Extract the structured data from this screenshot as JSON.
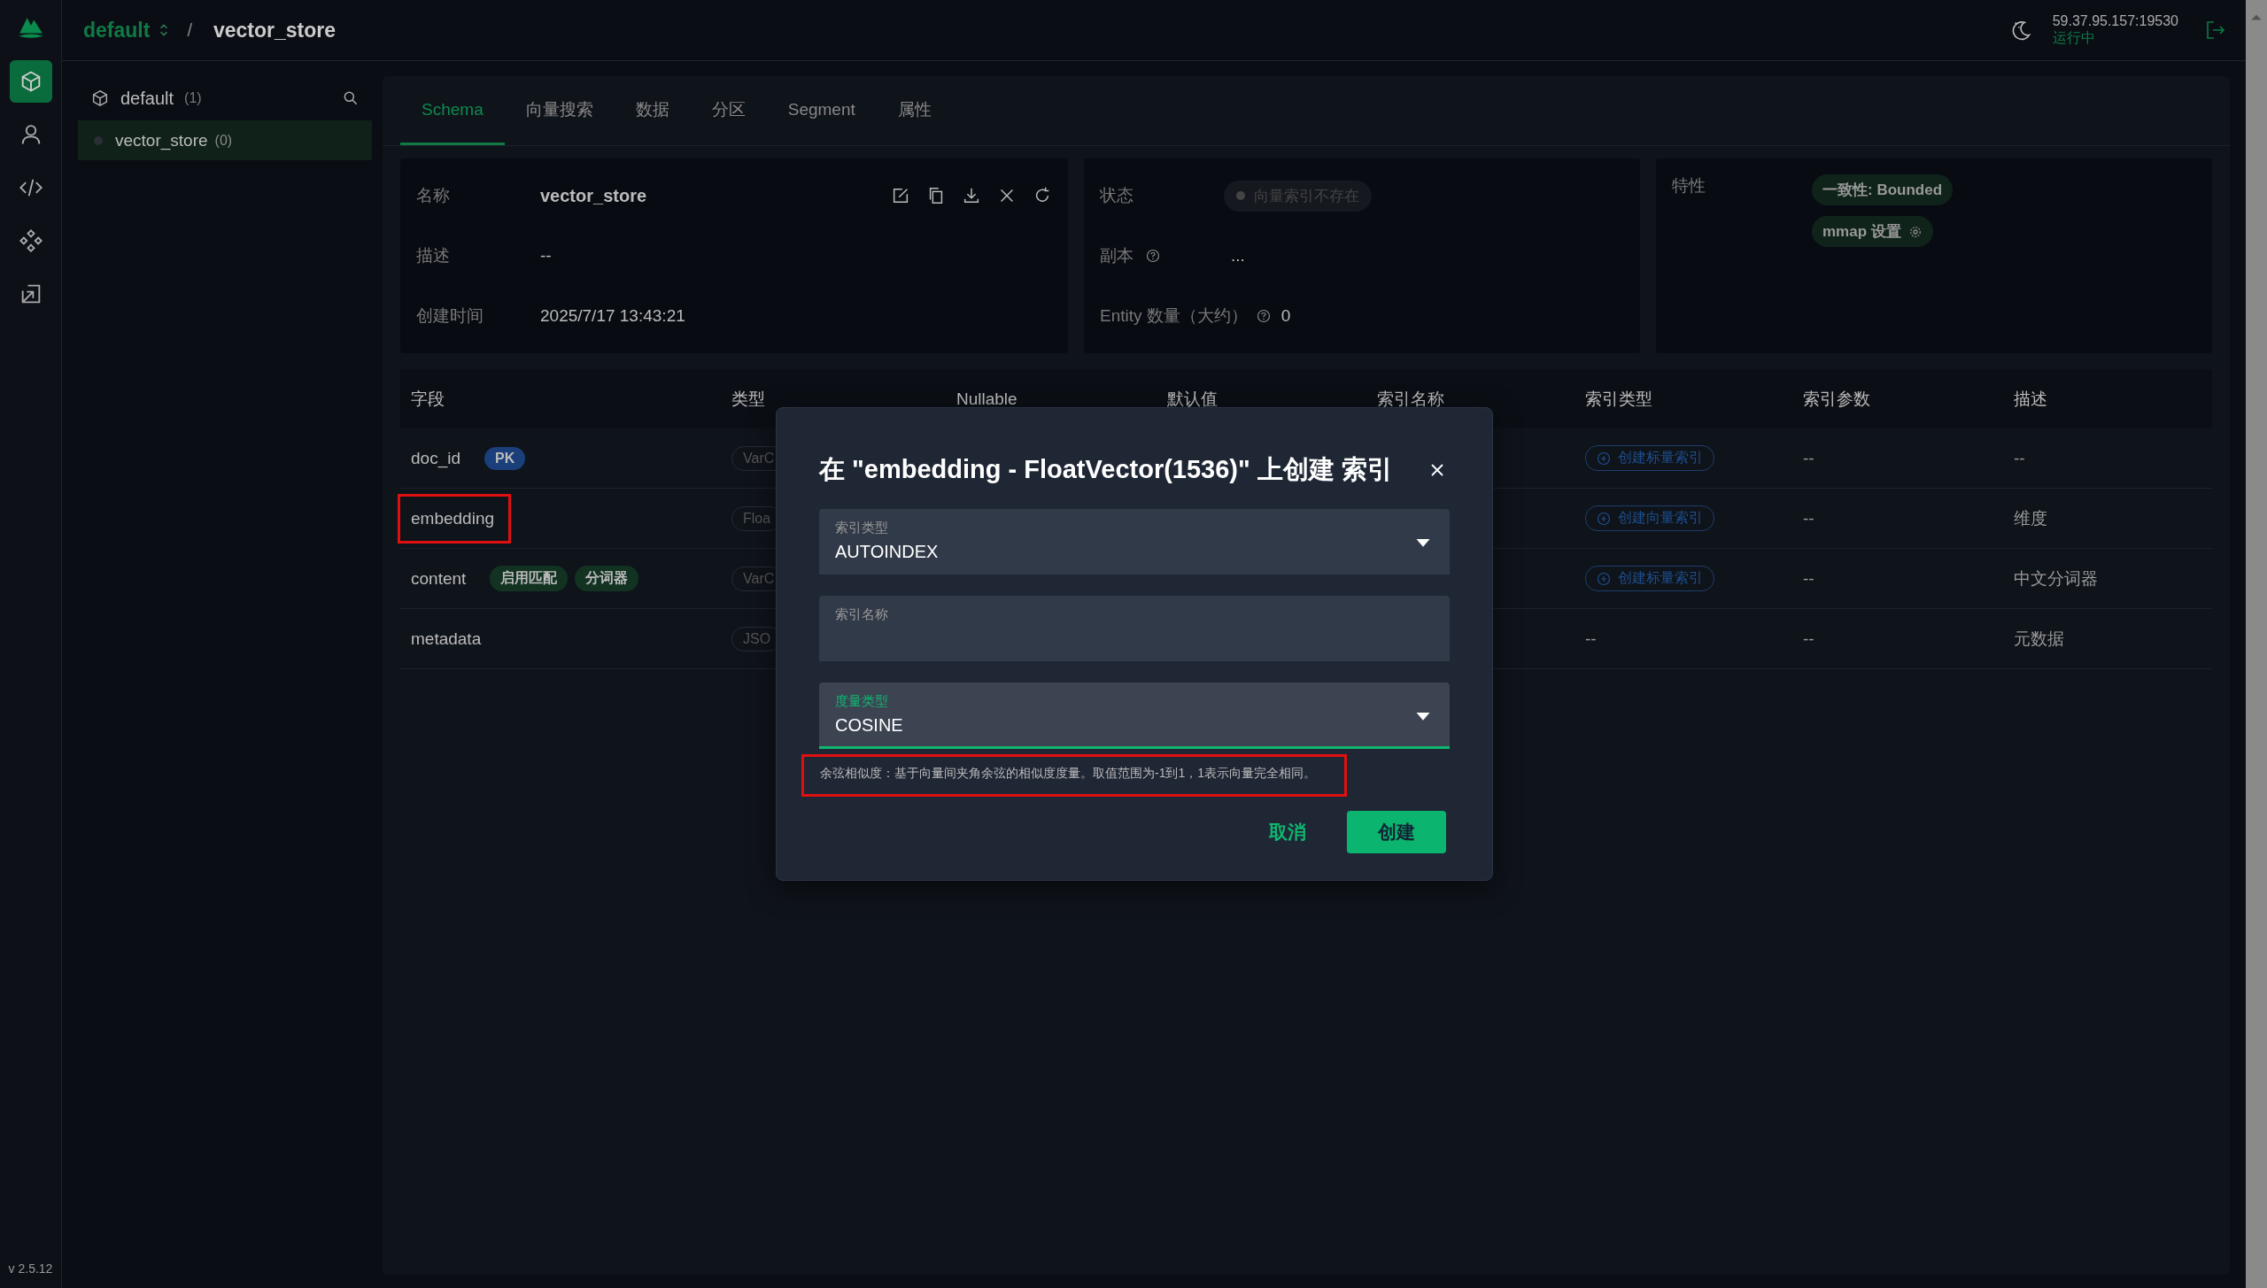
{
  "nav": [
    {
      "kind": "collections",
      "selected": true
    },
    {
      "kind": "users",
      "selected": false
    },
    {
      "kind": "code",
      "selected": false
    },
    {
      "kind": "plugins",
      "selected": false
    },
    {
      "kind": "import",
      "selected": false
    }
  ],
  "version": "v 2.5.12",
  "header": {
    "database": "default",
    "collection": "vector_store",
    "separator": "/",
    "server": "59.37.95.157:19530",
    "status": "运行中"
  },
  "tree": {
    "database": "default",
    "count": "(1)",
    "items": [
      {
        "name": "vector_store",
        "count": "(0)",
        "selected": true
      }
    ]
  },
  "tabs": [
    {
      "label": "Schema",
      "selected": true
    },
    {
      "label": "向量搜索",
      "selected": false
    },
    {
      "label": "数据",
      "selected": false
    },
    {
      "label": "分区",
      "selected": false
    },
    {
      "label": "Segment",
      "selected": false
    },
    {
      "label": "属性",
      "selected": false
    }
  ],
  "info": {
    "name_label": "名称",
    "name": "vector_store",
    "desc_label": "描述",
    "desc": "--",
    "created_label": "创建时间",
    "created": "2025/7/17 13:43:21",
    "state_label": "状态",
    "state": "向量索引不存在",
    "replica_label": "副本",
    "replica": "...",
    "entity_label": "Entity 数量（大约）",
    "entity": "0",
    "features_label": "特性",
    "features": [
      {
        "text": "一致性: Bounded",
        "kind": "plain"
      },
      {
        "text": "mmap 设置",
        "kind": "settings"
      }
    ]
  },
  "table": {
    "columns": [
      "字段",
      "类型",
      "Nullable",
      "默认值",
      "索引名称",
      "索引类型",
      "索引参数",
      "描述"
    ],
    "rows": [
      {
        "field": "doc_id",
        "highlighted": false,
        "tags": [
          {
            "text": "PK",
            "color": "#1a3f7a"
          }
        ],
        "type": "VarC",
        "index_type": {
          "kind": "button",
          "text": "创建标量索引"
        },
        "index_params": "--",
        "description": "--"
      },
      {
        "field": "embedding",
        "highlighted": true,
        "tags": [],
        "type": "Floa",
        "index_type": {
          "kind": "button",
          "text": "创建向量索引"
        },
        "index_params": "--",
        "description": "维度"
      },
      {
        "field": "content",
        "highlighted": false,
        "tags": [
          {
            "text": "启用匹配",
            "color": "#123222"
          },
          {
            "text": "分词器",
            "color": "#123222"
          }
        ],
        "type": "VarC",
        "index_type": {
          "kind": "button",
          "text": "创建标量索引"
        },
        "index_params": "--",
        "description": "中文分词器"
      },
      {
        "field": "metadata",
        "highlighted": false,
        "tags": [],
        "type": "JSO",
        "index_type": {
          "kind": "text",
          "text": "--"
        },
        "index_params": "--",
        "description": "元数据"
      }
    ]
  },
  "dialog": {
    "title": "在 \"embedding - FloatVector(1536)\" 上创建 索引",
    "fields": [
      {
        "kind": "select",
        "label": "索引类型",
        "value": "AUTOINDEX",
        "focused": false
      },
      {
        "kind": "text",
        "label": "索引名称",
        "focused": false
      },
      {
        "kind": "select",
        "label": "度量类型",
        "value": "COSINE",
        "focused": true
      }
    ],
    "helper": {
      "text": "余弦相似度：基于向量间夹角余弦的相似度度量。取值范围为-1到1，1表示向量完全相同。",
      "highlighted": true
    },
    "cancel": "取消",
    "create": "创建"
  }
}
